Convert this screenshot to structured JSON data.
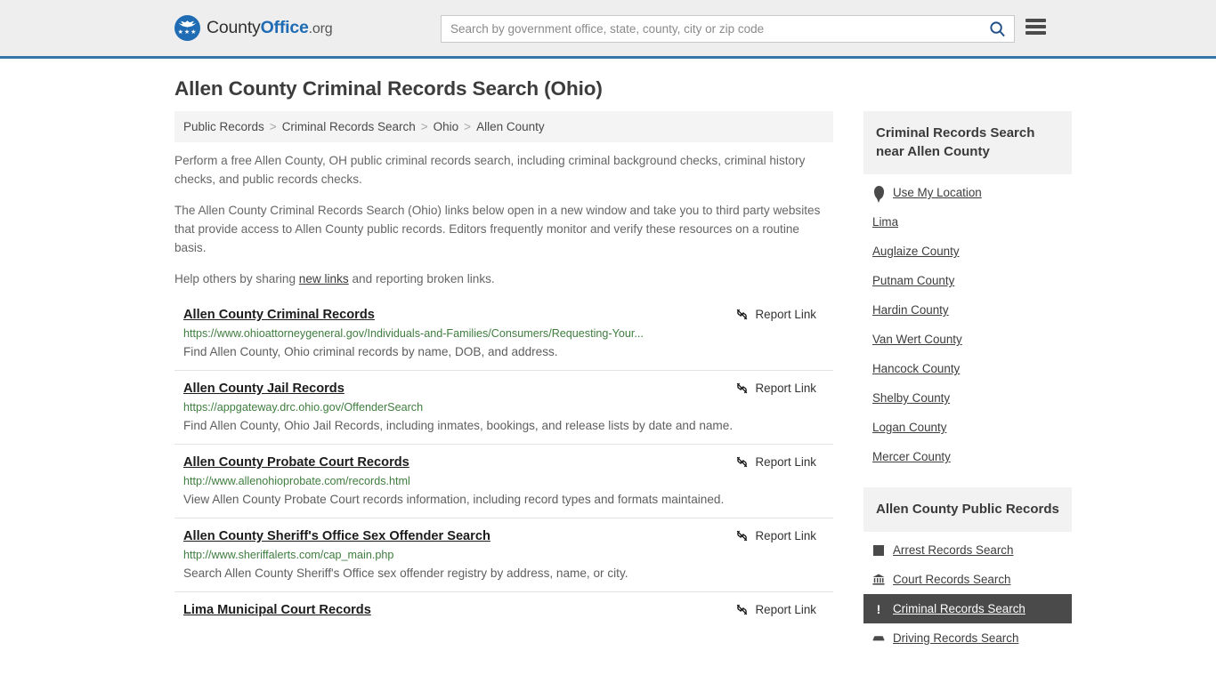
{
  "header": {
    "brand": {
      "county": "County",
      "office": "Office",
      "org": ".org",
      "logo_icon": "eagle-shield-icon",
      "stars": "★★★"
    },
    "search": {
      "placeholder": "Search by government office, state, county, city or zip code",
      "value": "",
      "search_icon": "search-icon"
    },
    "menu_icon": "hamburger-menu-icon"
  },
  "page": {
    "title": "Allen County Criminal Records Search (Ohio)"
  },
  "breadcrumb": {
    "separator": ">",
    "items": [
      {
        "label": "Public Records"
      },
      {
        "label": "Criminal Records Search"
      },
      {
        "label": "Ohio"
      },
      {
        "label": "Allen County"
      }
    ]
  },
  "intro": {
    "p1": "Perform a free Allen County, OH public criminal records search, including criminal background checks, criminal history checks, and public records checks.",
    "p2": "The Allen County Criminal Records Search (Ohio) links below open in a new window and take you to third party websites that provide access to Allen County public records. Editors frequently monitor and verify these resources on a routine basis.",
    "p3_before": "Help others by sharing ",
    "p3_link": "new links",
    "p3_after": " and reporting broken links."
  },
  "results": {
    "report_label": "Report Link",
    "report_icon": "broken-link-icon",
    "items": [
      {
        "title": "Allen County Criminal Records",
        "url": "https://www.ohioattorneygeneral.gov/Individuals-and-Families/Consumers/Requesting-Your...",
        "description": "Find Allen County, Ohio criminal records by name, DOB, and address."
      },
      {
        "title": "Allen County Jail Records",
        "url": "https://appgateway.drc.ohio.gov/OffenderSearch",
        "description": "Find Allen County, Ohio Jail Records, including inmates, bookings, and release lists by date and name."
      },
      {
        "title": "Allen County Probate Court Records",
        "url": "http://www.allenohioprobate.com/records.html",
        "description": "View Allen County Probate Court records information, including record types and formats maintained."
      },
      {
        "title": "Allen County Sheriff's Office Sex Offender Search",
        "url": "http://www.sheriffalerts.com/cap_main.php",
        "description": "Search Allen County Sheriff's Office sex offender registry by address, name, or city."
      },
      {
        "title": "Lima Municipal Court Records",
        "url": "",
        "description": ""
      }
    ]
  },
  "sidebar": {
    "nearby": {
      "heading": "Criminal Records Search near Allen County",
      "items": [
        {
          "label": "Use My Location",
          "icon": "map-pin-icon"
        },
        {
          "label": "Lima",
          "icon": ""
        },
        {
          "label": "Auglaize County",
          "icon": ""
        },
        {
          "label": "Putnam County",
          "icon": ""
        },
        {
          "label": "Hardin County",
          "icon": ""
        },
        {
          "label": "Van Wert County",
          "icon": ""
        },
        {
          "label": "Hancock County",
          "icon": ""
        },
        {
          "label": "Shelby County",
          "icon": ""
        },
        {
          "label": "Logan County",
          "icon": ""
        },
        {
          "label": "Mercer County",
          "icon": ""
        }
      ]
    },
    "public_records": {
      "heading": "Allen County Public Records",
      "items": [
        {
          "label": "Arrest Records Search",
          "icon": "fingerprint-icon",
          "active": false
        },
        {
          "label": "Court Records Search",
          "icon": "courthouse-icon",
          "active": false
        },
        {
          "label": "Criminal Records Search",
          "icon": "exclamation-icon",
          "active": true
        },
        {
          "label": "Driving Records Search",
          "icon": "car-icon",
          "active": false
        }
      ]
    }
  },
  "colors": {
    "brand_blue": "#1f6cb5",
    "header_border": "#3575a8",
    "header_bg": "#eeeeee",
    "url_green": "#3f7d3f",
    "active_bg": "#4a4a4a"
  }
}
